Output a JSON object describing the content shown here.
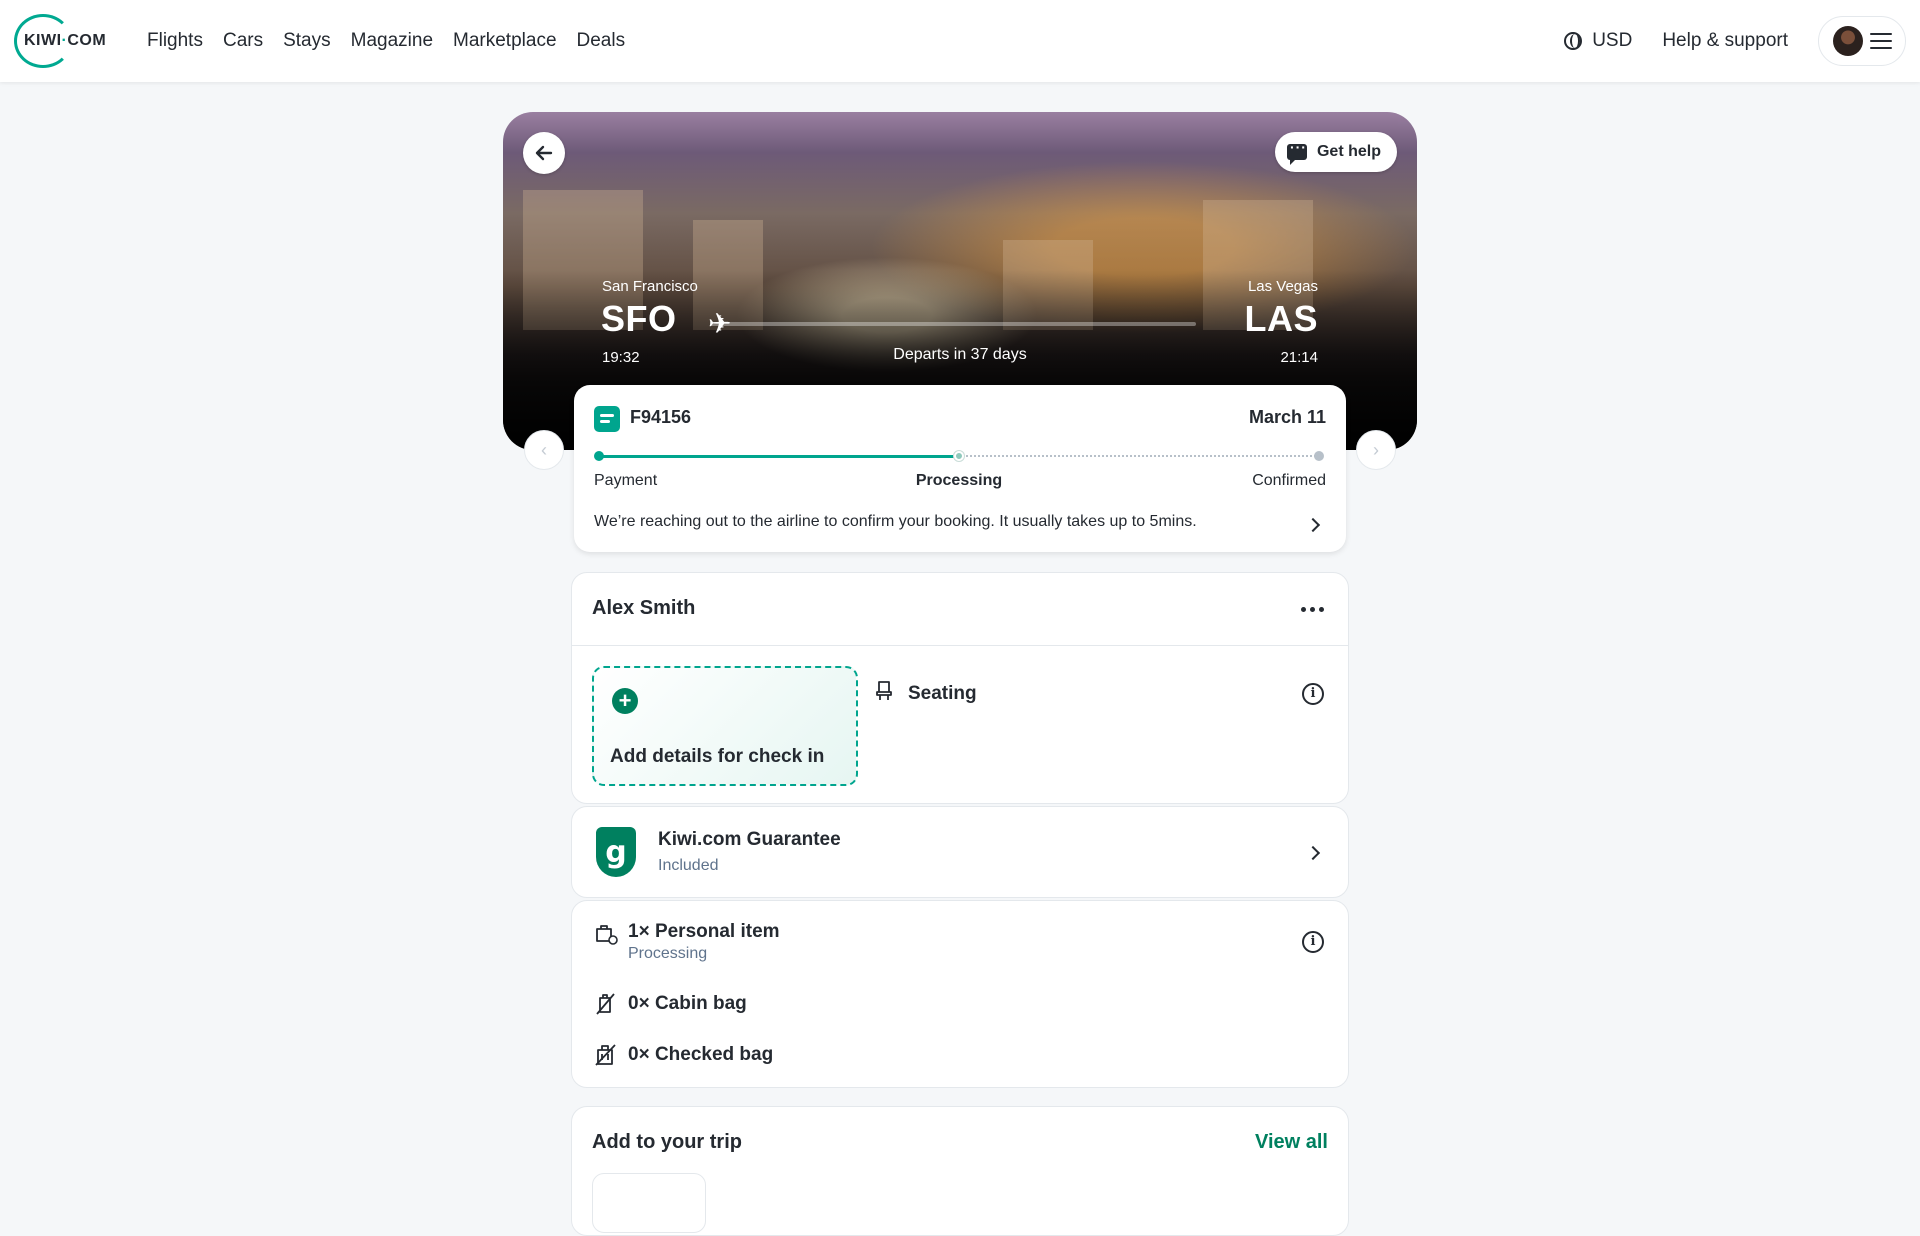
{
  "header": {
    "logo": "KIWI",
    "logo_dot": "·",
    "logo_suffix": "COM",
    "nav": [
      "Flights",
      "Cars",
      "Stays",
      "Magazine",
      "Marketplace",
      "Deals"
    ],
    "currency": "USD",
    "help": "Help & support"
  },
  "hero": {
    "get_help": "Get help",
    "origin": {
      "city": "San Francisco",
      "code": "SFO",
      "time": "19:32"
    },
    "destination": {
      "city": "Las Vegas",
      "code": "LAS",
      "time": "21:14"
    },
    "departs": "Departs in 37 days"
  },
  "status": {
    "booking_number": "F94156",
    "date": "March 11",
    "steps": [
      "Payment",
      "Processing",
      "Confirmed"
    ],
    "progress_step": 2,
    "message": "We’re reaching out to the airline to confirm your booking. It usually takes up to 5mins."
  },
  "passenger": {
    "name": "Alex Smith",
    "checkin_label": "Add details for check in",
    "seating_label": "Seating"
  },
  "guarantee": {
    "title": "Kiwi.com Guarantee",
    "subtitle": "Included",
    "shield_letter": "g"
  },
  "bags": {
    "personal": "1× Personal item",
    "personal_status": "Processing",
    "cabin": "0× Cabin bag",
    "checked": "0× Checked bag"
  },
  "trip": {
    "title": "Add to your trip",
    "view_all": "View all"
  },
  "colors": {
    "brand": "#00a991",
    "primary_green": "#00805f",
    "progress": "#00a58e"
  }
}
